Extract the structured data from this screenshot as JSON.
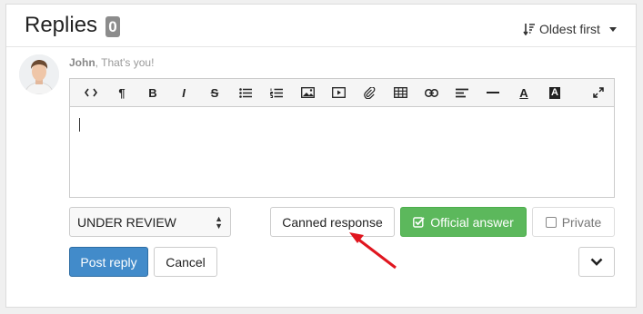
{
  "header": {
    "title": "Replies",
    "reply_count": "0",
    "sort_label": "Oldest first"
  },
  "author": {
    "name": "John",
    "note": ", That's you!"
  },
  "toolbar": {
    "items": [
      "code-view",
      "paragraph",
      "bold",
      "italic",
      "strikethrough",
      "bulleted-list",
      "numbered-list",
      "image",
      "video",
      "file-link",
      "table",
      "link",
      "align",
      "horizontal-rule",
      "font-color",
      "background-color"
    ],
    "labels": {
      "paragraph": "¶",
      "bold": "B",
      "italic": "I",
      "strike": "S",
      "font_color": "A",
      "bg_color": "A"
    }
  },
  "editor": {
    "value": ""
  },
  "status_select": {
    "value": "UNDER REVIEW"
  },
  "buttons": {
    "canned": "Canned response",
    "official": "Official answer",
    "private": "Private",
    "post": "Post reply",
    "cancel": "Cancel"
  },
  "colors": {
    "primary": "#428bca",
    "success": "#5cb85c",
    "badge": "#8c8c8c",
    "annotation_arrow": "#e0161f"
  }
}
